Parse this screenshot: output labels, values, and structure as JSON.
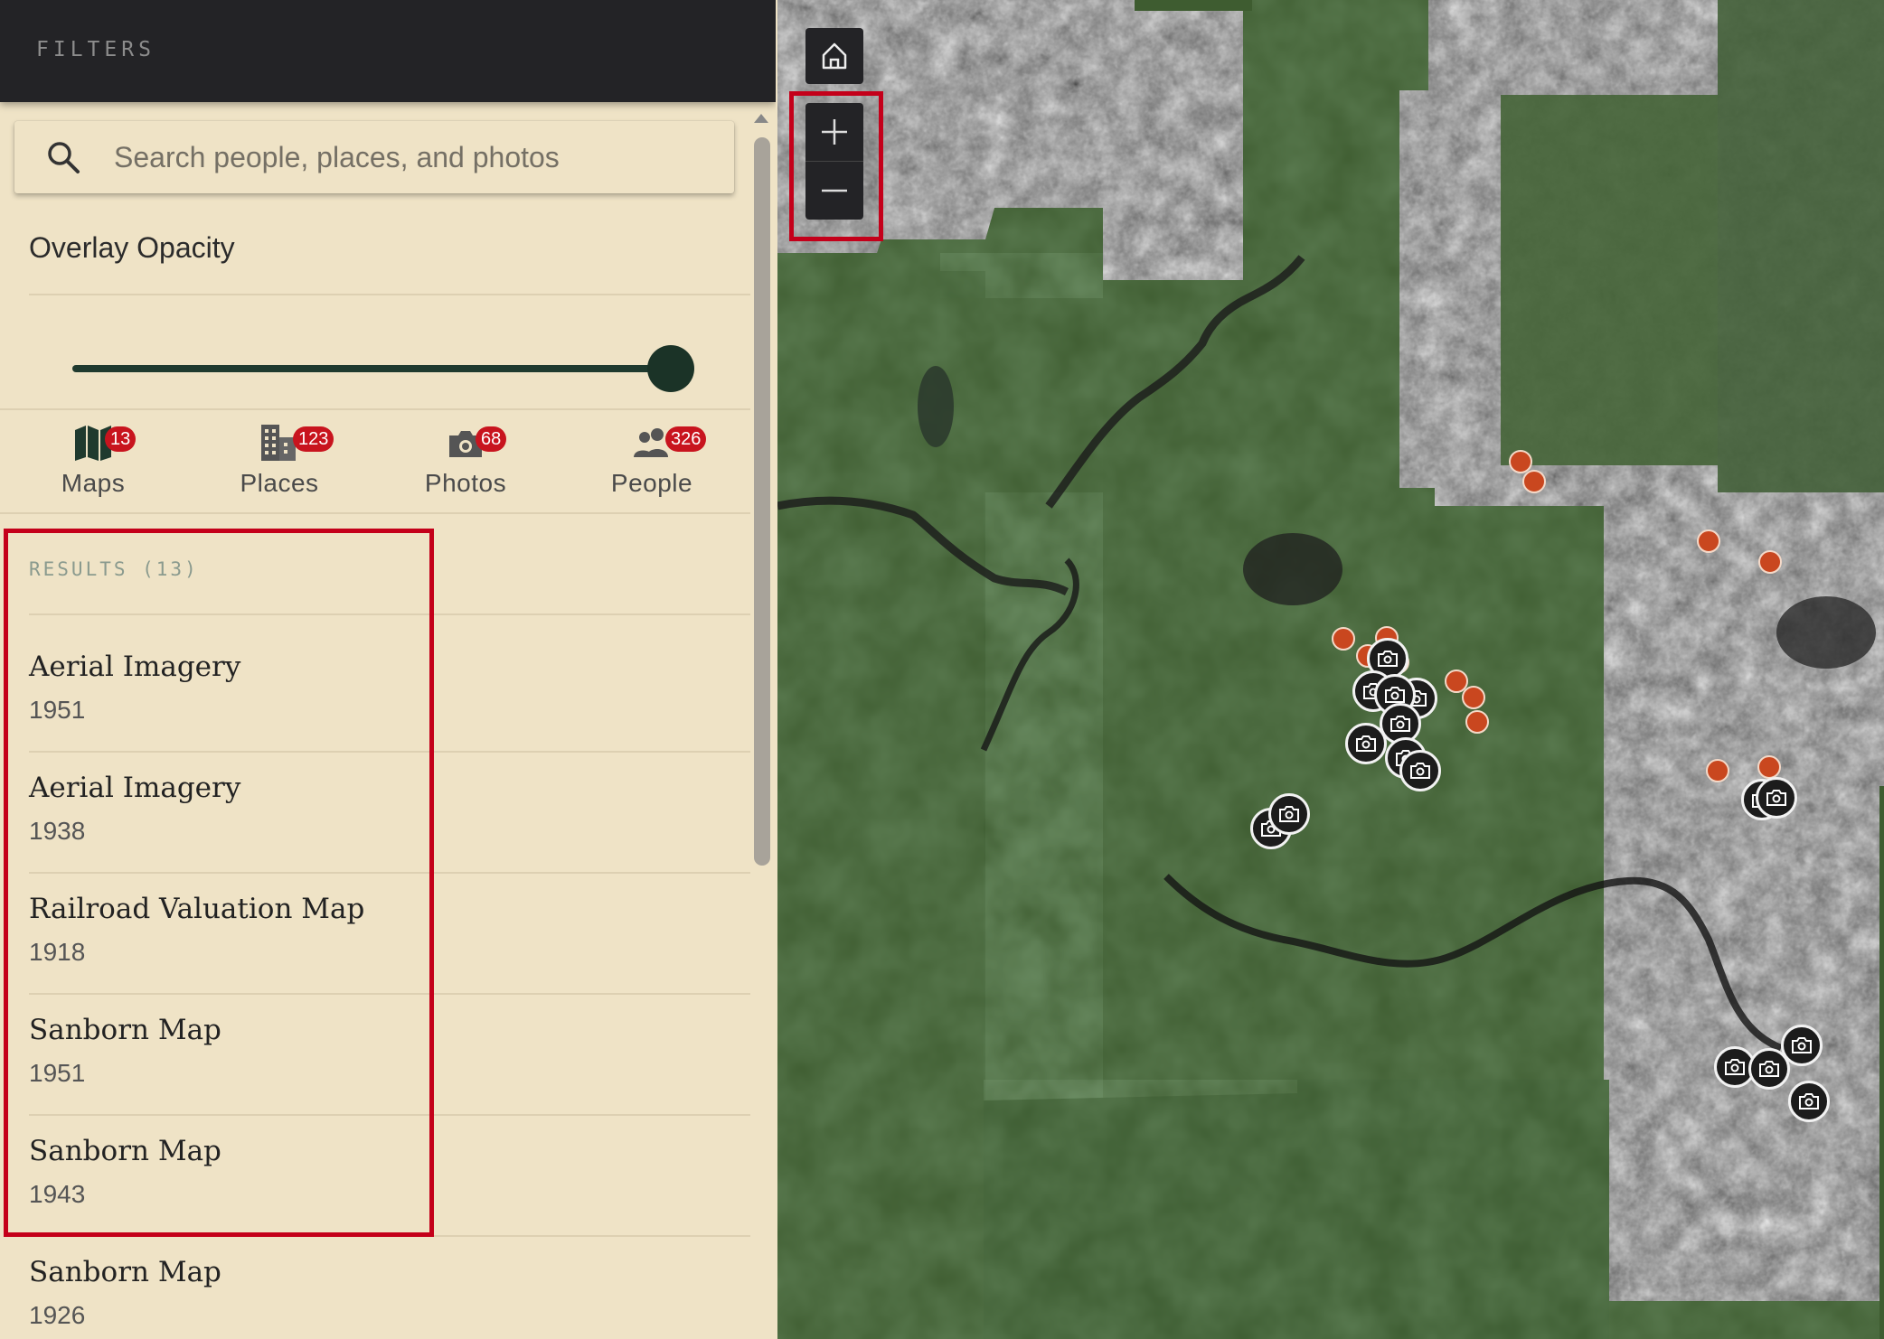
{
  "header": {
    "title": "FILTERS"
  },
  "search": {
    "placeholder": "Search people, places, and photos",
    "value": ""
  },
  "opacity": {
    "label": "Overlay Opacity",
    "value_percent": 100
  },
  "tabs": [
    {
      "label": "Maps",
      "count": "13",
      "icon": "map-icon"
    },
    {
      "label": "Places",
      "count": "123",
      "icon": "building-icon"
    },
    {
      "label": "Photos",
      "count": "68",
      "icon": "camera-icon"
    },
    {
      "label": "People",
      "count": "326",
      "icon": "people-icon"
    }
  ],
  "results": {
    "label": "RESULTS (13)",
    "items": [
      {
        "title": "Aerial Imagery",
        "year": "1951"
      },
      {
        "title": "Aerial Imagery",
        "year": "1938"
      },
      {
        "title": "Railroad Valuation Map",
        "year": "1918"
      },
      {
        "title": "Sanborn Map",
        "year": "1951"
      },
      {
        "title": "Sanborn Map",
        "year": "1943"
      },
      {
        "title": "Sanborn Map",
        "year": "1926"
      }
    ]
  },
  "colors": {
    "header_bg": "#232326",
    "sidebar_bg": "#efe3c6",
    "accent_dark_green": "#1b3327",
    "badge_red": "#c8141e",
    "highlight_red": "#c4001a",
    "place_marker": "#c9471f"
  },
  "map": {
    "controls": {
      "home": "home-icon",
      "zoom_in": "plus-icon",
      "zoom_out": "minus-icon"
    }
  }
}
